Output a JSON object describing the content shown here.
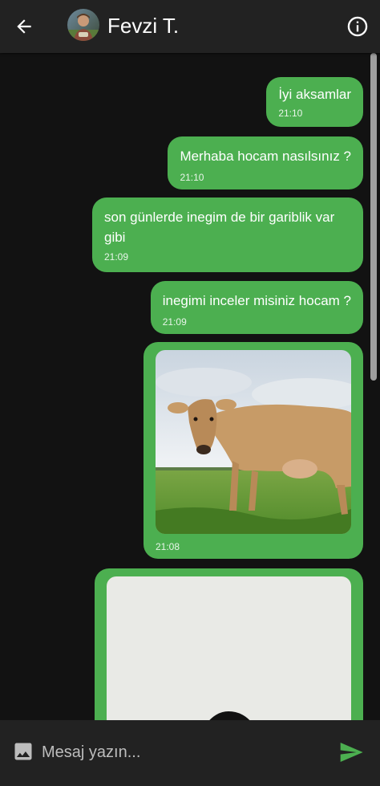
{
  "header": {
    "contact_name": "Fevzi T.",
    "back_icon": "arrow-left-icon",
    "info_icon": "info-icon"
  },
  "messages": [
    {
      "type": "text",
      "text": "İyi aksamlar",
      "time": "21:10"
    },
    {
      "type": "text",
      "text": "Merhaba hocam nasılsınız ?",
      "time": "21:10"
    },
    {
      "type": "text",
      "text": "son günlerde inegim de bir gariblik var gibi",
      "time": "21:09"
    },
    {
      "type": "text",
      "text": "inegimi inceler misiniz hocam ?",
      "time": "21:09"
    },
    {
      "type": "image",
      "image": "cow-photo",
      "time": "21:08"
    },
    {
      "type": "image",
      "image": "person-photo"
    }
  ],
  "composer": {
    "placeholder": "Mesaj yazın...",
    "gallery_icon": "image-icon",
    "send_icon": "send-icon"
  },
  "colors": {
    "bubble": "#4caf50",
    "background": "#121212",
    "bars": "#222222",
    "send_icon": "#4caf50"
  }
}
